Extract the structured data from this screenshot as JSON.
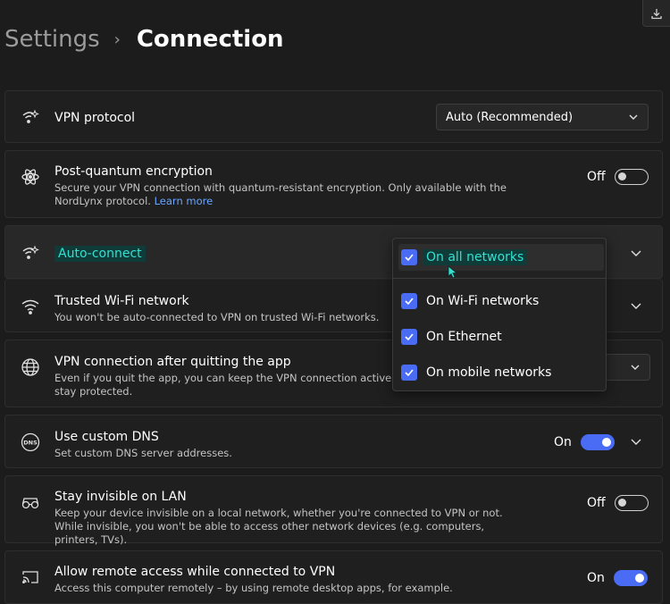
{
  "header": {
    "root": "Settings",
    "separator": "›",
    "current": "Connection"
  },
  "toolbar": {
    "download_icon": "download-icon"
  },
  "rows": {
    "vpn_protocol": {
      "title": "VPN protocol",
      "select_value": "Auto (Recommended)",
      "icon": "wifi-sparkle-icon"
    },
    "post_quantum": {
      "title": "Post-quantum encryption",
      "desc": "Secure your VPN connection with quantum-resistant encryption. Only available with the NordLynx protocol.",
      "link": "Learn more",
      "toggle_label": "Off",
      "icon": "atom-icon"
    },
    "auto_connect": {
      "title": "Auto-connect",
      "icon": "wifi-sparkle-icon"
    },
    "trusted_wifi": {
      "title": "Trusted Wi-Fi network",
      "desc": "You won't be auto-connected to VPN on trusted Wi-Fi networks.",
      "icon": "wifi-icon"
    },
    "after_quit": {
      "title": "VPN connection after quitting the app",
      "desc": "Even if you quit the app, you can keep the VPN connection active in the background to stay protected.",
      "icon": "globe-icon"
    },
    "custom_dns": {
      "title": "Use custom DNS",
      "desc": "Set custom DNS server addresses.",
      "toggle_label": "On",
      "icon": "dns-icon"
    },
    "invisible_lan": {
      "title": "Stay invisible on LAN",
      "desc": "Keep your device invisible on a local network, whether you're connected to VPN or not. While invisible, you won't be able to access other network devices (e.g. computers, printers, TVs).",
      "toggle_label": "Off",
      "icon": "glasses-icon"
    },
    "remote_access": {
      "title": "Allow remote access while connected to VPN",
      "desc": "Access this computer remotely – by using remote desktop apps, for example.",
      "toggle_label": "On",
      "icon": "cast-icon"
    }
  },
  "dropdown": {
    "items": [
      {
        "label": "On all networks",
        "checked": true
      },
      {
        "label": "On Wi-Fi networks",
        "checked": true
      },
      {
        "label": "On Ethernet",
        "checked": true
      },
      {
        "label": "On mobile networks",
        "checked": true
      }
    ]
  },
  "colors": {
    "accent": "#4a6cf5",
    "highlight_bg": "#0f3b39",
    "highlight_text": "#35e0d0",
    "link": "#6aa5ff"
  }
}
